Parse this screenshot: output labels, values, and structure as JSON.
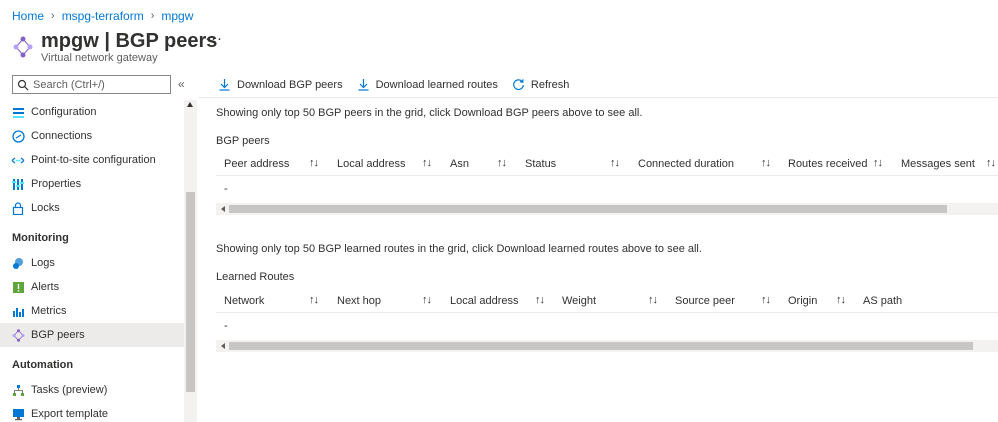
{
  "breadcrumb": {
    "items": [
      "Home",
      "mspg-terraform",
      "mpgw"
    ]
  },
  "header": {
    "title": "mpgw | BGP peers",
    "subtitle": "Virtual network gateway",
    "more": "···"
  },
  "sidebar": {
    "search_placeholder": "Search (Ctrl+/)",
    "collapse": "«",
    "items": [
      {
        "label": "Configuration",
        "icon": "configuration-icon"
      },
      {
        "label": "Connections",
        "icon": "connections-icon"
      },
      {
        "label": "Point-to-site configuration",
        "icon": "point-to-site-icon"
      },
      {
        "label": "Properties",
        "icon": "properties-icon"
      },
      {
        "label": "Locks",
        "icon": "lock-icon"
      }
    ],
    "monitoring_label": "Monitoring",
    "monitoring_items": [
      {
        "label": "Logs",
        "icon": "logs-icon"
      },
      {
        "label": "Alerts",
        "icon": "alerts-icon"
      },
      {
        "label": "Metrics",
        "icon": "metrics-icon"
      },
      {
        "label": "BGP peers",
        "icon": "bgp-peers-icon",
        "active": true
      }
    ],
    "automation_label": "Automation",
    "automation_items": [
      {
        "label": "Tasks (preview)",
        "icon": "tasks-icon"
      },
      {
        "label": "Export template",
        "icon": "export-template-icon"
      }
    ]
  },
  "toolbar": {
    "download_peers": "Download BGP peers",
    "download_routes": "Download learned routes",
    "refresh": "Refresh"
  },
  "peers": {
    "info": "Showing only top 50 BGP peers in the grid, click Download BGP peers above to see all.",
    "title": "BGP peers",
    "columns": [
      "Peer address",
      "Local address",
      "Asn",
      "Status",
      "Connected duration",
      "Routes received",
      "Messages sent"
    ],
    "empty_row": "-"
  },
  "routes": {
    "info": "Showing only top 50 BGP learned routes in the grid, click Download learned routes above to see all.",
    "title": "Learned Routes",
    "columns": [
      "Network",
      "Next hop",
      "Local address",
      "Weight",
      "Source peer",
      "Origin",
      "AS path"
    ],
    "empty_row": "-"
  },
  "sort_glyph": "↑↓",
  "colors": {
    "link": "#0078d4",
    "active_bg": "#edebe9",
    "accent": "#0078d4"
  }
}
